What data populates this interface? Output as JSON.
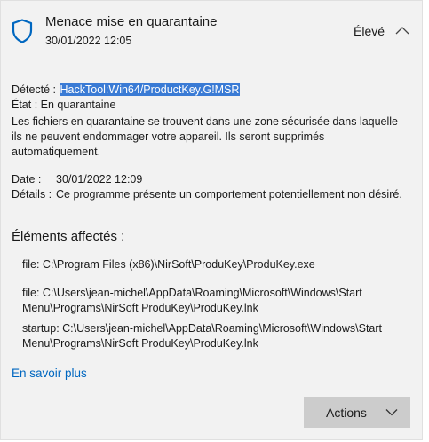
{
  "notification": {
    "title": "Menace mise en quarantaine",
    "date": "30/01/2022 12:05",
    "severity": "Élevé"
  },
  "details": {
    "detected_label": "Détecté :",
    "detected_value": "HackTool:Win64/ProductKey.G!MSR",
    "status_label": "État :",
    "status_value": "En quarantaine",
    "quarantine_text": "Les fichiers en quarantaine se trouvent dans une zone sécurisée dans laquelle ils ne peuvent endommager votre appareil. Ils seront supprimés automatiquement.",
    "date_label": "Date :",
    "date_value": "30/01/2022 12:09",
    "details_label": "Détails :",
    "details_value": "Ce programme présente un comportement potentiellement non désiré."
  },
  "affected": {
    "title": "Éléments affectés :",
    "items": [
      "file: C:\\Program Files (x86)\\NirSoft\\ProduKey\\ProduKey.exe",
      "file: C:\\Users\\jean-michel\\AppData\\Roaming\\Microsoft\\Windows\\Start Menu\\Programs\\NirSoft ProduKey\\ProduKey.lnk",
      "startup: C:\\Users\\jean-michel\\AppData\\Roaming\\Microsoft\\Windows\\Start Menu\\Programs\\NirSoft ProduKey\\ProduKey.lnk"
    ]
  },
  "learn_more": "En savoir plus",
  "actions_label": "Actions",
  "colors": {
    "accent": "#0067c0",
    "selection": "#3a7bd5",
    "card_bg": "#f2f2f2",
    "button_bg": "#cccccc"
  },
  "icons": {
    "header": "shield-icon",
    "collapse": "chevron-up-icon",
    "actions": "chevron-down-icon"
  }
}
